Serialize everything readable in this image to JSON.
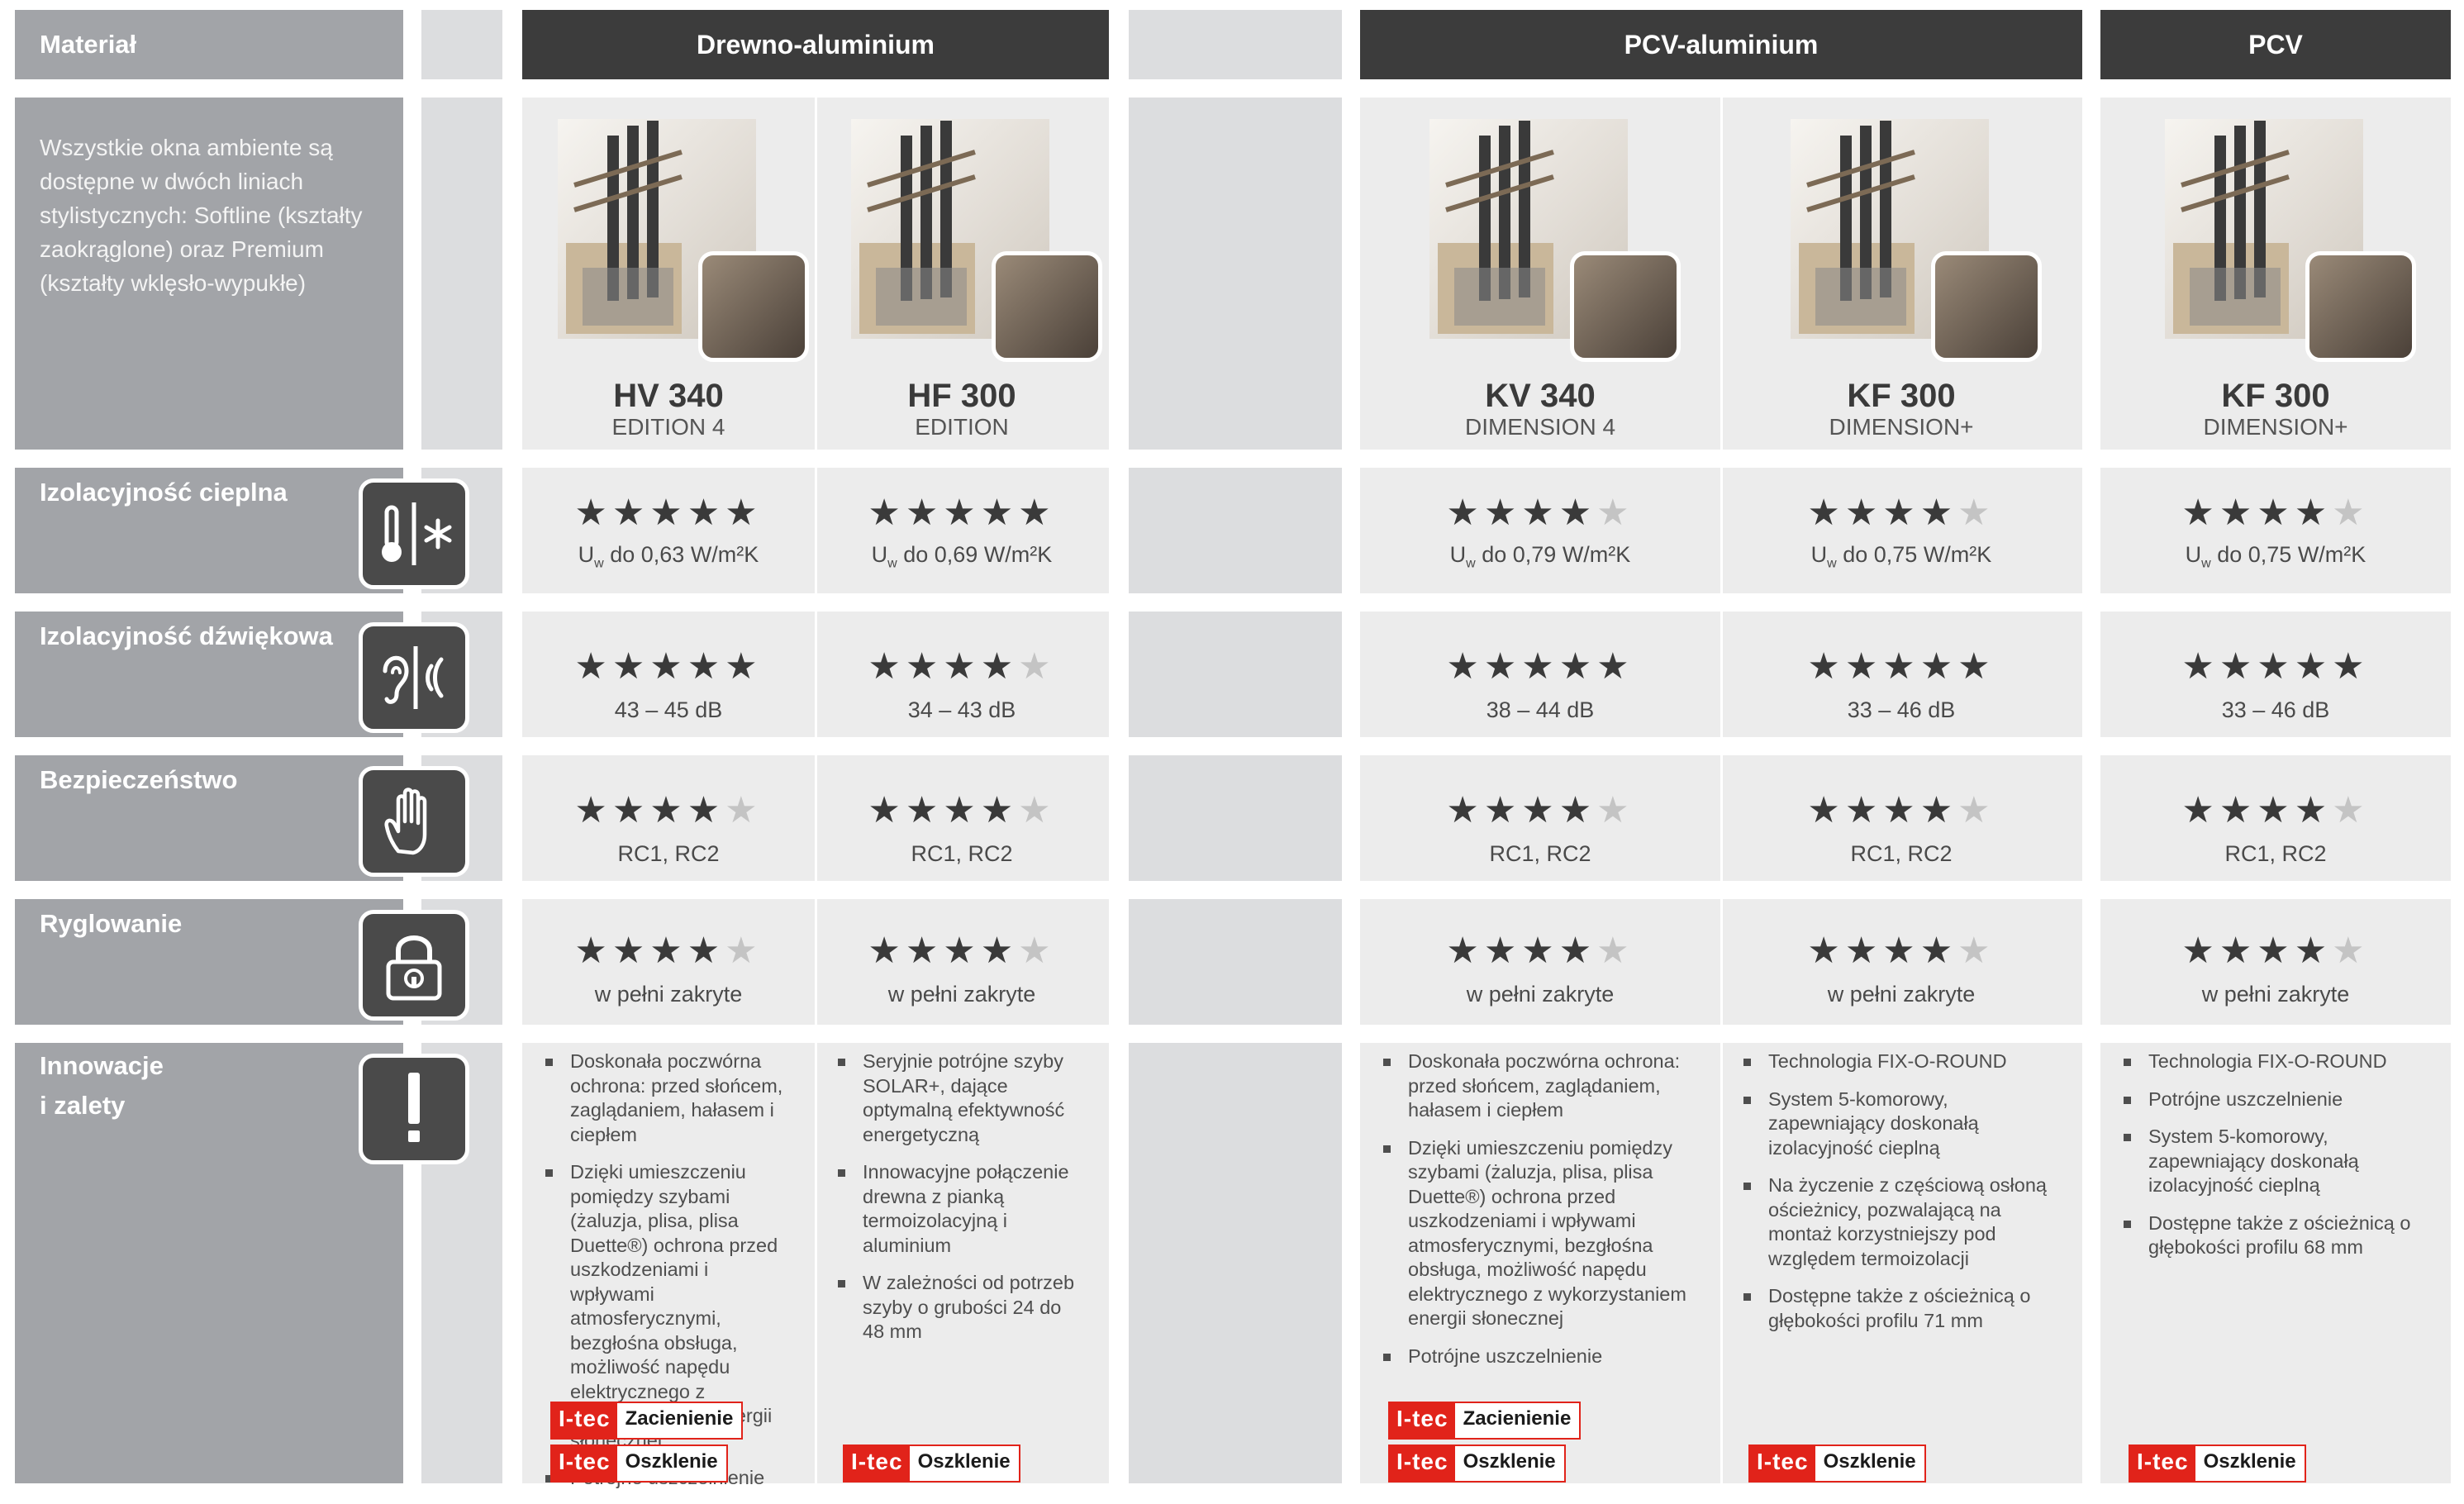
{
  "header": {
    "material_label": "Materiał",
    "groups": [
      "Drewno-aluminium",
      "PCV-aluminium",
      "PCV"
    ]
  },
  "intro_text": "Wszystkie okna ambiente są dostępne w dwóch liniach stylistycznych: Softline (kształty zaokrąglone) oraz Premium (kształty wklęsło-wypukłe)",
  "rows": {
    "thermal": {
      "label": "Izolacyjność cieplna",
      "icon": "thermometer-snowflake-icon"
    },
    "acoustic": {
      "label": "Izolacyjność dźwiękowa",
      "icon": "ear-sound-icon"
    },
    "security": {
      "label": "Bezpieczeństwo",
      "icon": "hand-icon"
    },
    "locking": {
      "label": "Ryglowanie",
      "icon": "padlock-icon"
    },
    "innovations": {
      "label_line1": "Innowacje",
      "label_line2": "i zalety",
      "icon": "exclamation-icon"
    }
  },
  "products": [
    {
      "name": "HV 340",
      "edition": "EDITION 4",
      "thermal": {
        "stars": 5,
        "u_symbol": "U",
        "u_sub": "w",
        "value": " do 0,63 W/m²K"
      },
      "acoustic": {
        "stars": 5,
        "value": "43 – 45 dB"
      },
      "security": {
        "stars": 4,
        "value": "RC1, RC2"
      },
      "locking": {
        "stars": 4,
        "value": "w pełni zakryte"
      },
      "innovations": [
        "Doskonała poczwórna ochrona: przed słońcem, zaglądaniem, hałasem i ciepłem",
        "Dzięki umieszczeniu pomiędzy szybami (żaluzja, plisa, plisa Duette®) ochrona przed uszkodzeniami i wpływami atmosferycznymi, bezgłośna obsługa, możliwość napędu elektrycznego z wykorzystaniem energii słonecznej",
        "Potrójne uszczelnienie"
      ],
      "badges": [
        "Zacienienie",
        "Oszklenie"
      ]
    },
    {
      "name": "HF 300",
      "edition": "EDITION",
      "thermal": {
        "stars": 5,
        "u_symbol": "U",
        "u_sub": "w",
        "value": " do 0,69 W/m²K"
      },
      "acoustic": {
        "stars": 4,
        "value": "34 – 43 dB"
      },
      "security": {
        "stars": 4,
        "value": "RC1, RC2"
      },
      "locking": {
        "stars": 4,
        "value": "w pełni zakryte"
      },
      "innovations": [
        "Seryjnie potrójne szyby SOLAR+, dające optymalną efektywność energetyczną",
        "Innowacyjne połączenie drewna z pianką termoizolacyjną i aluminium",
        "W zależności od potrzeb szyby o grubości 24 do 48 mm"
      ],
      "badges": [
        "Oszklenie"
      ]
    },
    {
      "name": "KV 340",
      "edition": "DIMENSION 4",
      "thermal": {
        "stars": 4,
        "u_symbol": "U",
        "u_sub": "w",
        "value": " do 0,79 W/m²K"
      },
      "acoustic": {
        "stars": 5,
        "value": "38 – 44 dB"
      },
      "security": {
        "stars": 4,
        "value": "RC1, RC2"
      },
      "locking": {
        "stars": 4,
        "value": "w pełni zakryte"
      },
      "innovations": [
        "Doskonała poczwórna ochrona: przed słońcem, zaglądaniem, hałasem i ciepłem",
        "Dzięki umieszczeniu pomiędzy szybami (żaluzja, plisa, plisa Duette®) ochrona przed uszkodzeniami i wpływami atmosferycznymi, bezgłośna obsługa, możliwość napędu elektrycznego z wykorzystaniem energii słonecznej",
        "Potrójne uszczelnienie"
      ],
      "badges": [
        "Zacienienie",
        "Oszklenie"
      ]
    },
    {
      "name": "KF 300",
      "edition": "DIMENSION+",
      "thermal": {
        "stars": 4,
        "u_symbol": "U",
        "u_sub": "w",
        "value": " do 0,75 W/m²K"
      },
      "acoustic": {
        "stars": 5,
        "value": "33 – 46 dB"
      },
      "security": {
        "stars": 4,
        "value": "RC1, RC2"
      },
      "locking": {
        "stars": 4,
        "value": "w pełni zakryte"
      },
      "innovations": [
        "Technologia FIX-O-ROUND",
        "System 5-komorowy, zapewniający doskonałą izolacyjność cieplną",
        "Na życzenie z częściową osłoną ościeżnicy, pozwalającą na montaż korzystniejszy pod względem termoizolacji",
        "Dostępne także z ościeżnicą o głębokości profilu 71 mm"
      ],
      "badges": [
        "Oszklenie"
      ]
    },
    {
      "name": "KF 300",
      "edition": "DIMENSION+",
      "thermal": {
        "stars": 4,
        "u_symbol": "U",
        "u_sub": "w",
        "value": " do 0,75 W/m²K"
      },
      "acoustic": {
        "stars": 5,
        "value": "33 – 46 dB"
      },
      "security": {
        "stars": 4,
        "value": "RC1, RC2"
      },
      "locking": {
        "stars": 4,
        "value": "w pełni zakryte"
      },
      "innovations": [
        "Technologia FIX-O-ROUND",
        "Potrójne uszczelnienie",
        "System 5-komorowy, zapewniający doskonałą izolacyjność cieplną",
        "Dostępne także z ościeżnicą o głębokości profilu 68 mm"
      ],
      "badges": [
        "Oszklenie"
      ]
    }
  ],
  "badge_logo": "I-tec",
  "colors": {
    "label_bg": "#a2a4a8",
    "header_dark": "#3c3c3c",
    "cell_bg": "#ececec",
    "spacer_bg": "#dcdddf",
    "star_on": "#3a3a3a",
    "star_off": "#c4c4c4",
    "brand_red": "#e1231a"
  }
}
